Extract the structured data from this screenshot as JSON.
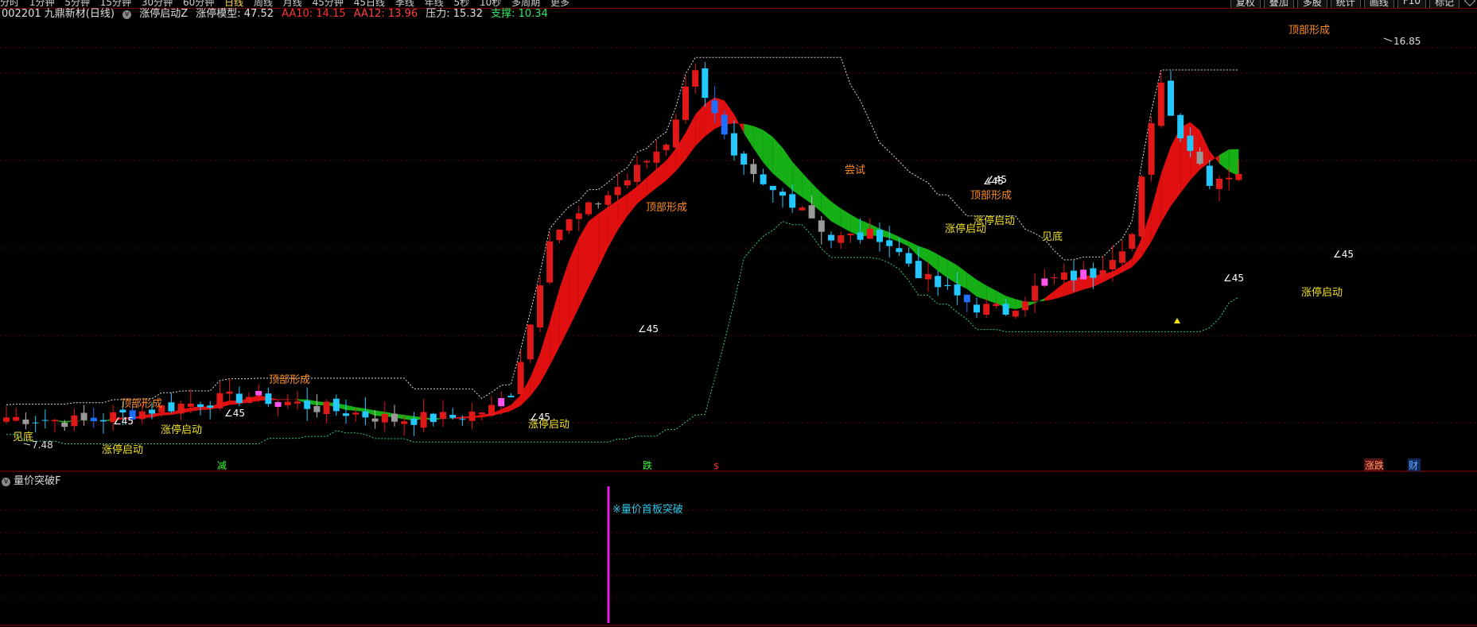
{
  "top_toolbar": {
    "period_tabs": [
      "分时",
      "1分钟",
      "5分钟",
      "15分钟",
      "30分钟",
      "60分钟",
      "日线",
      "周线",
      "月线",
      "45分钟",
      "45日线",
      "季线",
      "年线",
      "5秒",
      "10秒",
      "多周期",
      "更多"
    ],
    "right_buttons": [
      "复权",
      "叠加",
      "多股",
      "统计",
      "画线",
      "F10",
      "标记"
    ]
  },
  "info_bar": {
    "code_name": "002201 九鼎新材(日线)",
    "indicator_name": "涨停启动Z",
    "model_label": "涨停模型:",
    "model_value": "47.52",
    "aa10": "AA10: 14.15",
    "aa12": "AA12: 13.96",
    "pressure": "压力: 15.32",
    "support": "支撑: 10.34"
  },
  "main_chart": {
    "price_annotations": {
      "high": "16.85",
      "low": "7.48"
    },
    "labels": {
      "top_form": "顶部形成",
      "limit_start": "涨停启动",
      "angle45": "∠45",
      "bottom": "见底",
      "try_up": "尝试"
    },
    "bottom_markers": [
      "减",
      "跌",
      "$",
      "涨跌",
      "财"
    ]
  },
  "indicator_panel": {
    "title": "量价突破F",
    "signal_text": "※量价首板突破"
  },
  "colors": {
    "up": "#e01818",
    "down_cyan": "#22c8ff",
    "ribbon_red": "#e01010",
    "ribbon_green": "#16b016",
    "pressure_line": "#dddddd",
    "support_line": "#33cc77",
    "label_orange": "#ff8c20",
    "label_yellow": "#f2e12a",
    "signal_magenta": "#e81ce8",
    "signal_text": "#30c8e8"
  }
}
